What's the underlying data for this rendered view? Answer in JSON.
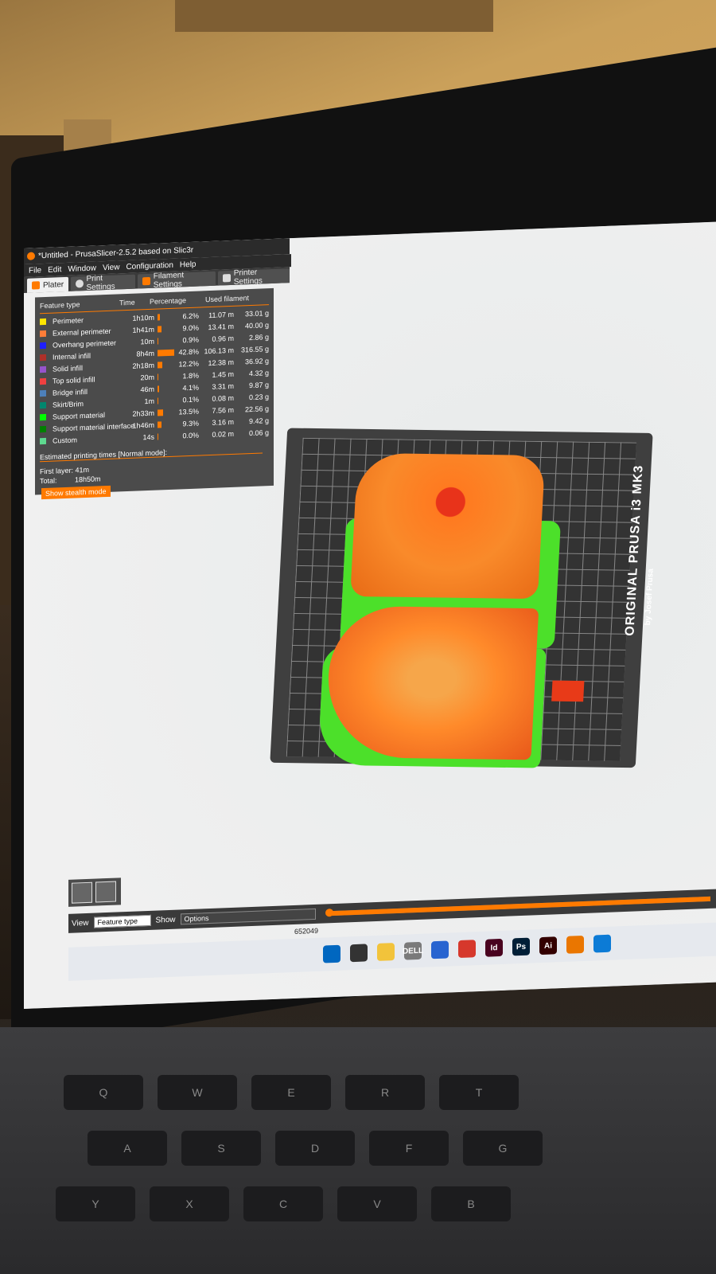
{
  "window": {
    "title": "*Untitled - PrusaSlicer-2.5.2 based on Slic3r"
  },
  "menu": [
    "File",
    "Edit",
    "Window",
    "View",
    "Configuration",
    "Help"
  ],
  "tabs": [
    {
      "label": "Plater",
      "active": true
    },
    {
      "label": "Print Settings",
      "active": false
    },
    {
      "label": "Filament Settings",
      "active": false
    },
    {
      "label": "Printer Settings",
      "active": false
    }
  ],
  "legend": {
    "headers": {
      "feature": "Feature type",
      "time": "Time",
      "percentage": "Percentage",
      "filament": "Used filament"
    },
    "rows": [
      {
        "name": "Perimeter",
        "time": "1h10m",
        "pct": "6.2%",
        "len": "11.07 m",
        "wt": "33.01 g",
        "color": "#ffe600",
        "frac": 0.062
      },
      {
        "name": "External perimeter",
        "time": "1h41m",
        "pct": "9.0%",
        "len": "13.41 m",
        "wt": "40.00 g",
        "color": "#ff7d38",
        "frac": 0.09
      },
      {
        "name": "Overhang perimeter",
        "time": "10m",
        "pct": "0.9%",
        "len": "0.96 m",
        "wt": "2.86 g",
        "color": "#1f1fff",
        "frac": 0.009
      },
      {
        "name": "Internal infill",
        "time": "8h4m",
        "pct": "42.8%",
        "len": "106.13 m",
        "wt": "316.55 g",
        "color": "#b03029",
        "frac": 0.428
      },
      {
        "name": "Solid infill",
        "time": "2h18m",
        "pct": "12.2%",
        "len": "12.38 m",
        "wt": "36.92 g",
        "color": "#9654cc",
        "frac": 0.122
      },
      {
        "name": "Top solid infill",
        "time": "20m",
        "pct": "1.8%",
        "len": "1.45 m",
        "wt": "4.32 g",
        "color": "#f04040",
        "frac": 0.018
      },
      {
        "name": "Bridge infill",
        "time": "46m",
        "pct": "4.1%",
        "len": "3.31 m",
        "wt": "9.87 g",
        "color": "#4d80ba",
        "frac": 0.041
      },
      {
        "name": "Skirt/Brim",
        "time": "1m",
        "pct": "0.1%",
        "len": "0.08 m",
        "wt": "0.23 g",
        "color": "#00876e",
        "frac": 0.001
      },
      {
        "name": "Support material",
        "time": "2h33m",
        "pct": "13.5%",
        "len": "7.56 m",
        "wt": "22.56 g",
        "color": "#00ff00",
        "frac": 0.135
      },
      {
        "name": "Support material interface",
        "time": "1h46m",
        "pct": "9.3%",
        "len": "3.16 m",
        "wt": "9.42 g",
        "color": "#008000",
        "frac": 0.093
      },
      {
        "name": "Custom",
        "time": "14s",
        "pct": "0.0%",
        "len": "0.02 m",
        "wt": "0.06 g",
        "color": "#5ed98f",
        "frac": 0.0
      }
    ],
    "estimated_title": "Estimated printing times [Normal mode]:",
    "first_layer_label": "First layer:",
    "first_layer_value": "41m",
    "total_label": "Total:",
    "total_value": "18h50m",
    "stealth_button": "Show stealth mode"
  },
  "bed": {
    "label": "ORIGINAL PRUSA i3 MK3",
    "sub": "by Josef Prusa"
  },
  "bottombar": {
    "view_label": "View",
    "view_value": "Feature type",
    "show_label": "Show",
    "show_value": "Options",
    "slider_value": "652049"
  },
  "taskbar": [
    {
      "name": "windows-start-icon",
      "label": "",
      "color": "#0067c0"
    },
    {
      "name": "task-view-icon",
      "label": "",
      "color": "#333333"
    },
    {
      "name": "file-explorer-icon",
      "label": "",
      "color": "#f2c33b"
    },
    {
      "name": "dell-icon",
      "label": "DELL",
      "color": "#7a7a7a"
    },
    {
      "name": "todo-icon",
      "label": "",
      "color": "#2864d0"
    },
    {
      "name": "chrome-icon",
      "label": "",
      "color": "#d6382c"
    },
    {
      "name": "indesign-icon",
      "label": "Id",
      "color": "#49021f"
    },
    {
      "name": "photoshop-icon",
      "label": "Ps",
      "color": "#001e36"
    },
    {
      "name": "illustrator-icon",
      "label": "Ai",
      "color": "#330000"
    },
    {
      "name": "blender-icon",
      "label": "",
      "color": "#ea7600"
    },
    {
      "name": "edge-icon",
      "label": "",
      "color": "#0c7bd6"
    }
  ],
  "keyboard_rows": [
    [
      "Q",
      "W",
      "E",
      "R",
      "T"
    ],
    [
      "A",
      "S",
      "D",
      "F",
      "G"
    ],
    [
      "Y",
      "X",
      "C",
      "V",
      "B"
    ]
  ]
}
